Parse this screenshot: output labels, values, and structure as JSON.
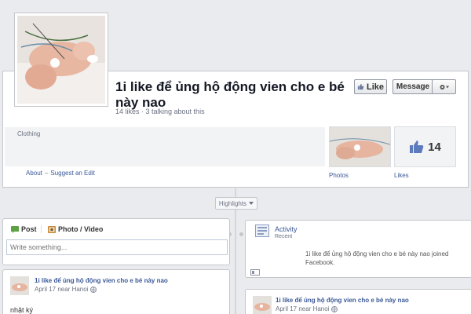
{
  "page": {
    "title": "1i like để ủng hộ động vien cho e bé này nao",
    "meta": "14 likes · 3 talking about this",
    "category": "Clothing"
  },
  "actions": {
    "like_label": "Like",
    "message_label": "Message"
  },
  "links": {
    "about": "About",
    "suggest_edit": "Suggest an Edit"
  },
  "apps": {
    "photos_label": "Photos",
    "likes_label": "Likes",
    "likes_count": "14"
  },
  "timeline": {
    "highlights_label": "Highlights"
  },
  "composer": {
    "post_tab": "Post",
    "photo_tab": "Photo / Video",
    "placeholder": "Write something..."
  },
  "post": {
    "author": "1i like để ủng hộ động vien cho e bé này nao",
    "date": "April 17 near Hanoi",
    "text": "nhật ký"
  },
  "activity": {
    "title": "Activity",
    "subtitle": "Recent",
    "text": "1i like để ủng hộ động vien cho e bé này nao joined Facebook."
  },
  "post2": {
    "author": "1i like để ủng hộ động vien cho e bé này nao",
    "date": "April 17 near Hanoi"
  },
  "colors": {
    "link": "#3b5998",
    "background": "#e9ebee"
  }
}
